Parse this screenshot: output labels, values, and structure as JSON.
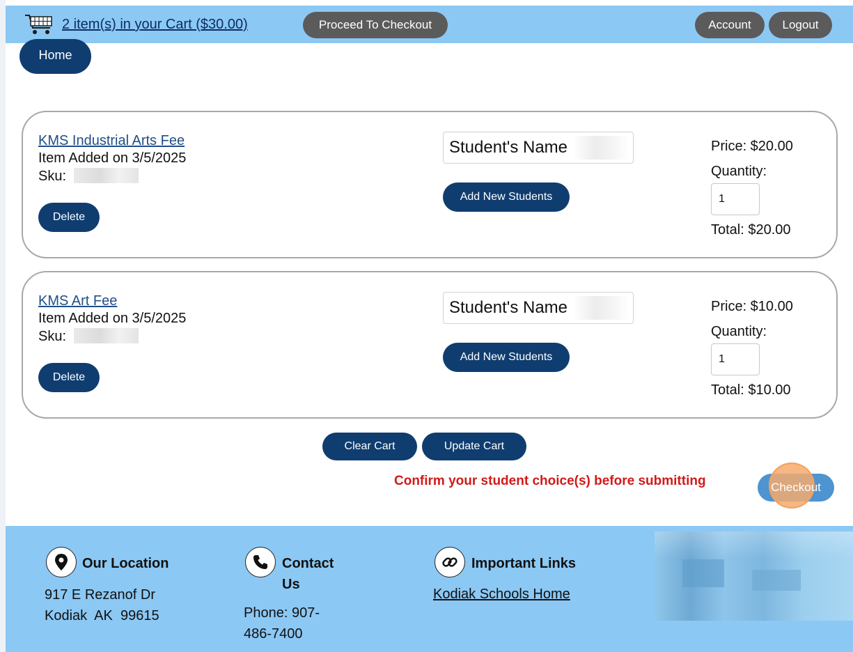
{
  "header": {
    "cart_summary": "2 item(s) in your Cart ($30.00)",
    "proceed_label": "Proceed To Checkout",
    "account_label": "Account",
    "logout_label": "Logout"
  },
  "nav": {
    "home_label": "Home"
  },
  "cart_items": [
    {
      "name": "KMS Industrial Arts Fee",
      "added": "Item Added on 3/5/2025",
      "sku_label": "Sku:",
      "delete_label": "Delete",
      "student_value": "Student's Name",
      "add_students_label": "Add New Students",
      "price": "Price: $20.00",
      "quantity_label": "Quantity:",
      "quantity": "1",
      "total": "Total: $20.00"
    },
    {
      "name": "KMS Art Fee",
      "added": "Item Added on 3/5/2025",
      "sku_label": "Sku:",
      "delete_label": "Delete",
      "student_value": "Student's Name",
      "add_students_label": "Add New Students",
      "price": "Price: $10.00",
      "quantity_label": "Quantity:",
      "quantity": "1",
      "total": "Total: $10.00"
    }
  ],
  "actions": {
    "clear_label": "Clear Cart",
    "update_label": "Update Cart",
    "confirm_message": "Confirm your student choice(s) before submitting",
    "checkout_label": "Checkout"
  },
  "footer": {
    "location_title": "Our Location",
    "address_line1": "917 E Rezanof Dr",
    "address_line2": "Kodiak  AK  99615",
    "contact_title_1": "Contact",
    "contact_title_2": "Us",
    "phone_line1": "Phone: 907-",
    "phone_line2": "486-7400",
    "links_title": "Important Links",
    "link_1": "Kodiak Schools Home"
  },
  "colors": {
    "bar_blue": "#8cc8f4",
    "navy": "#0f3d70",
    "gray_pill": "#5b5b5b",
    "warning_red": "#d11a1a",
    "checkout_blue": "#4d94d0"
  }
}
